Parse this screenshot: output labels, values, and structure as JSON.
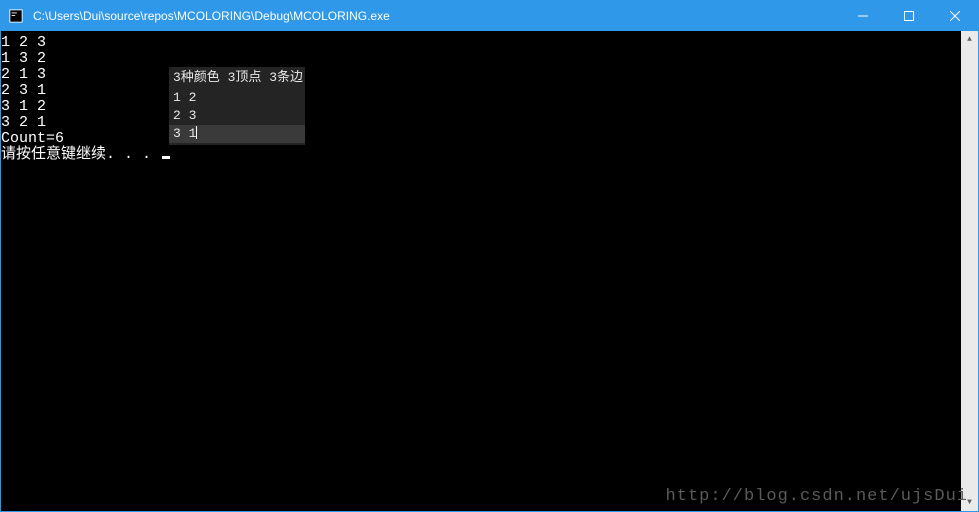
{
  "window": {
    "title": "C:\\Users\\Dui\\source\\repos\\MCOLORING\\Debug\\MCOLORING.exe"
  },
  "console": {
    "lines": [
      "1 2 3",
      "1 3 2",
      "2 1 3",
      "2 3 1",
      "3 1 2",
      "3 2 1",
      "Count=6",
      "请按任意键继续. . . "
    ]
  },
  "annotation": {
    "header": "3种颜色 3顶点 3条边",
    "rows": [
      "1 2",
      "2 3",
      "3 1"
    ]
  },
  "watermark": "http://blog.csdn.net/ujsDui"
}
